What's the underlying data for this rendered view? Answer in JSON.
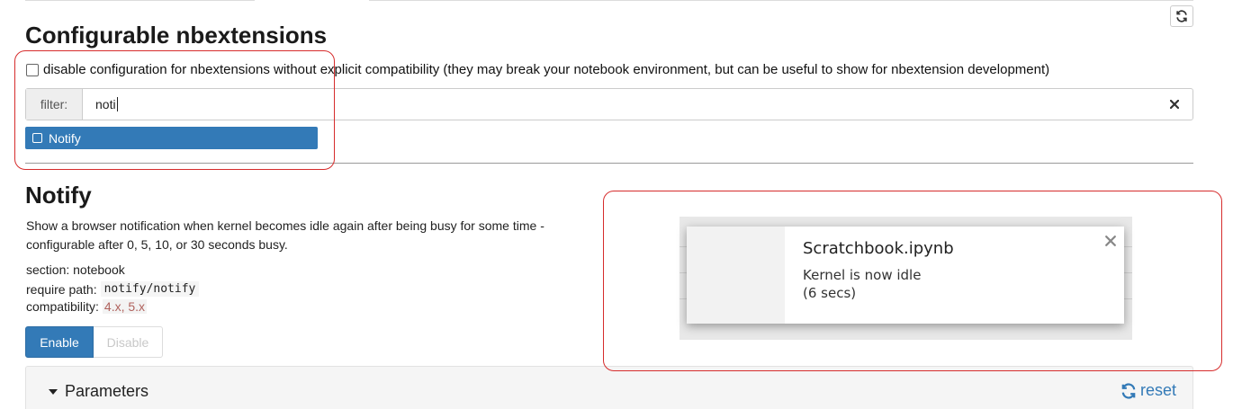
{
  "header": {
    "title": "Configurable nbextensions"
  },
  "compat_option": {
    "label": "disable configuration for nbextensions without explicit compatibility (they may break your notebook environment, but can be useful to show for nbextension development)",
    "checked": false
  },
  "filter": {
    "label": "filter:",
    "value": "noti"
  },
  "extension_list": [
    {
      "label": "Notify"
    }
  ],
  "extension": {
    "title": "Notify",
    "description": "Show a browser notification when kernel becomes idle again after being busy for some time - configurable after 0, 5, 10, or 30 seconds busy.",
    "section_label": "section: notebook",
    "require_label": "require path:",
    "require_value": "notify/notify",
    "compat_label": "compatibility:",
    "compat_value": "4.x, 5.x",
    "enable_label": "Enable",
    "disable_label": "Disable"
  },
  "parameters": {
    "label": "Parameters",
    "reset_label": "reset"
  },
  "notification_preview": {
    "title": "Scratchbook.ipynb",
    "line1": "Kernel is now idle",
    "line2": "(6 secs)"
  },
  "icons": [
    "refresh-icon",
    "clear-icon",
    "checkbox-icon",
    "caret-down-icon",
    "reset-icon",
    "close-icon"
  ],
  "colors": {
    "accent": "#337ab7",
    "annotation": "#d62c2c",
    "compat_value": "#b0625d"
  }
}
